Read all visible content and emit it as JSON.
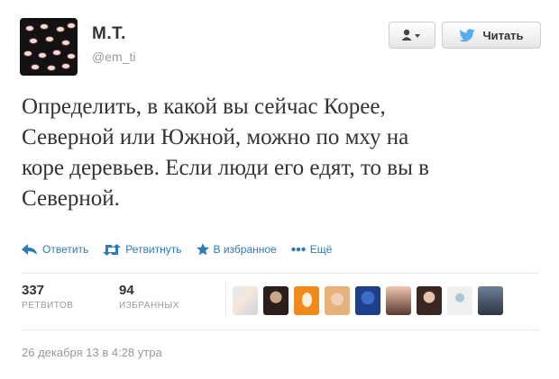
{
  "user": {
    "name": "М.Т.",
    "handle": "@em_ti"
  },
  "buttons": {
    "follow_label": "Читать"
  },
  "tweet": {
    "lines": [
      "Определить, в какой вы сейчас Корее,",
      "Северной или Южной, можно по мху на",
      "коре деревьев. Если люди его едят, то вы в",
      "Северной."
    ]
  },
  "actions": {
    "reply": "Ответить",
    "retweet": "Ретвитнуть",
    "favorite": "В избранное",
    "more": "Ещё"
  },
  "stats": {
    "retweets_count": "337",
    "retweets_label": "РЕТВИТОВ",
    "favorites_count": "94",
    "favorites_label": "ИЗБРАННЫХ"
  },
  "timestamp": "26 декабря 13 в 4:28 утра",
  "colors": {
    "link": "#2b7bb9",
    "twitter_bird": "#55acee",
    "text": "#333333",
    "muted": "#999999"
  }
}
